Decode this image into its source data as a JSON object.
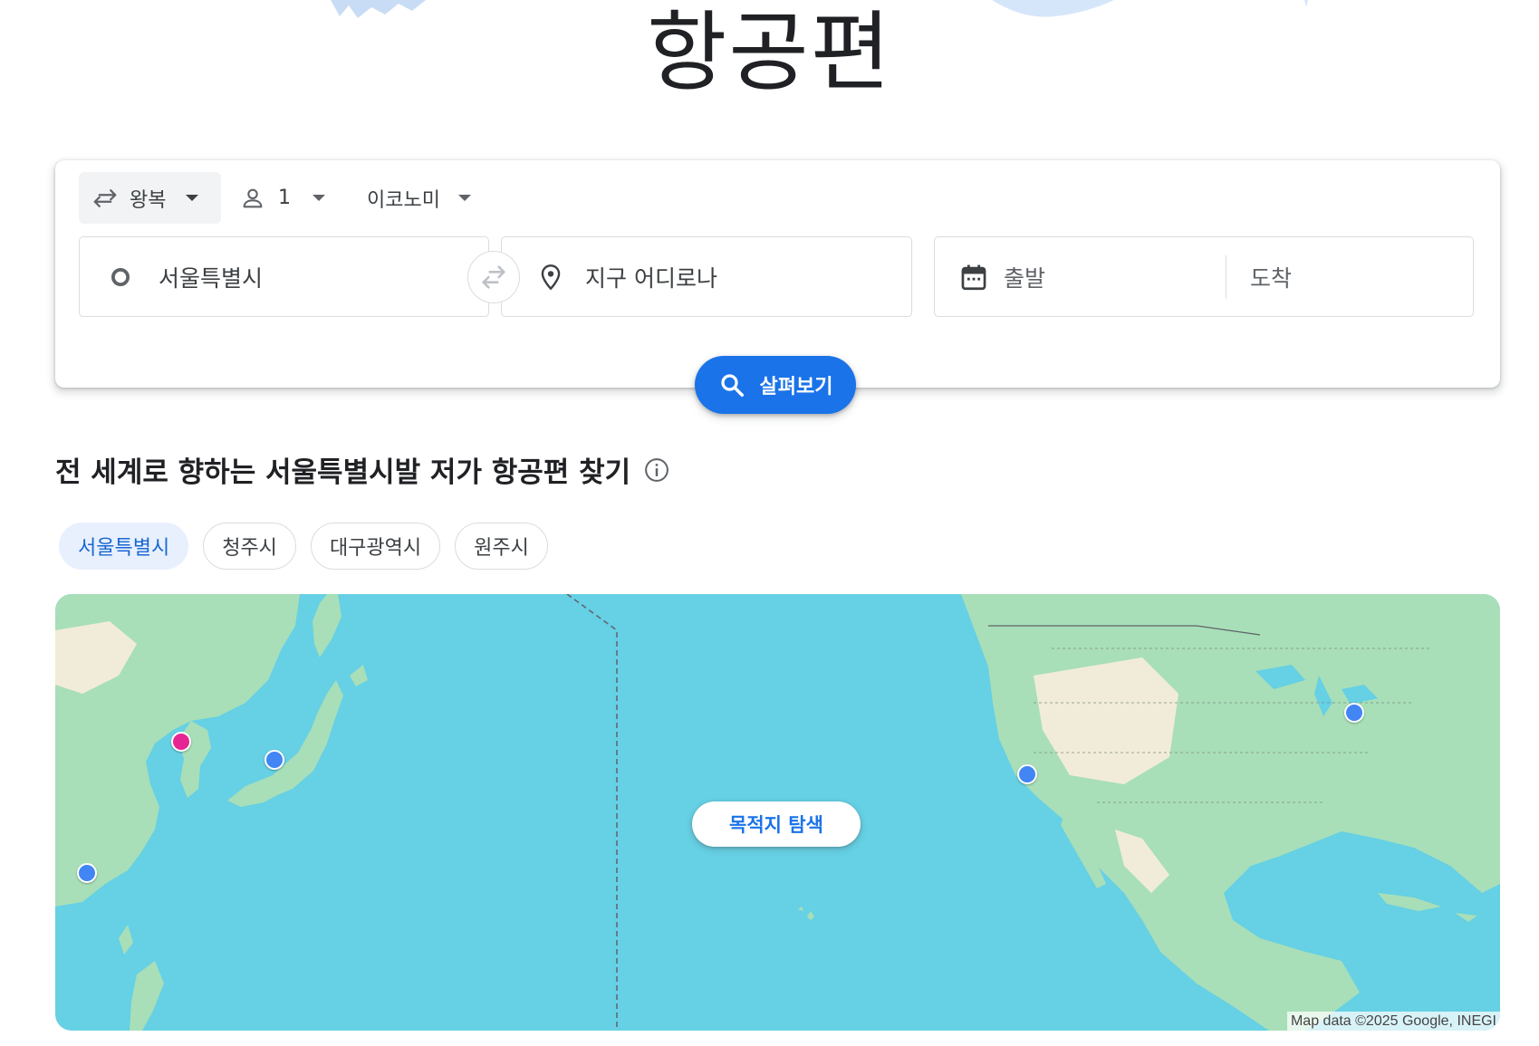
{
  "page": {
    "title": "항공편"
  },
  "search": {
    "trip_type": "왕복",
    "passengers": "1",
    "cabin_class": "이코노미",
    "origin_value": "서울특별시",
    "destination_placeholder": "지구 어디로나",
    "departure_placeholder": "출발",
    "return_placeholder": "도착",
    "explore_label": "살펴보기"
  },
  "explore_section": {
    "title": "전 세계로 향하는 서울특별시발 저가 항공편 찾기",
    "chips": [
      {
        "label": "서울특별시",
        "active": true
      },
      {
        "label": "청주시",
        "active": false
      },
      {
        "label": "대구광역시",
        "active": false
      },
      {
        "label": "원주시",
        "active": false
      }
    ]
  },
  "map": {
    "explore_destinations_label": "목적지 탐색",
    "attribution": "Map data ©2025 Google, INEGI",
    "colors": {
      "ocean": "#66d0e4",
      "land": "#a8dfb8",
      "desert": "#f1ecd9",
      "home_pin": "#e52592",
      "destination_pin": "#4285f4"
    }
  },
  "colors": {
    "primary": "#1a73e8",
    "chip_active_bg": "#e8f0fe",
    "chip_active_text": "#1967d2"
  }
}
